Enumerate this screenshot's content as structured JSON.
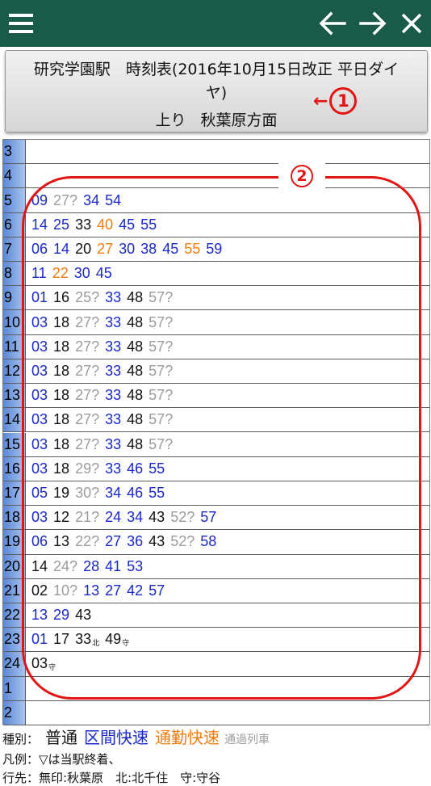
{
  "header": {
    "line1": "研究学園駅　時刻表(2016年10月15日改正 平日ダイ",
    "line2": "ヤ)",
    "direction": "上り",
    "destination": "秋葉原方面"
  },
  "annotations": {
    "marker1": "①",
    "marker1_arrow": "←",
    "marker2": "②",
    "accent": "#e31414"
  },
  "colors": {
    "topbar": "#1a5a48",
    "normal": "#111111",
    "rapid": "#1a28c8",
    "commute": "#f07c10",
    "pass": "#9c9c9c",
    "hour_cell": "#7aa2e4"
  },
  "icons": [
    "menu-icon",
    "back-arrow-icon",
    "forward-arrow-icon",
    "close-icon"
  ],
  "timetable": [
    {
      "hour": "3",
      "trains": []
    },
    {
      "hour": "4",
      "trains": []
    },
    {
      "hour": "5",
      "trains": [
        {
          "m": "09",
          "t": "rapid"
        },
        {
          "m": "27?",
          "t": "pass"
        },
        {
          "m": "34",
          "t": "rapid"
        },
        {
          "m": "54",
          "t": "rapid"
        }
      ]
    },
    {
      "hour": "6",
      "trains": [
        {
          "m": "14",
          "t": "rapid"
        },
        {
          "m": "25",
          "t": "rapid"
        },
        {
          "m": "33",
          "t": "normal"
        },
        {
          "m": "40",
          "t": "commute"
        },
        {
          "m": "45",
          "t": "rapid"
        },
        {
          "m": "55",
          "t": "rapid"
        }
      ]
    },
    {
      "hour": "7",
      "trains": [
        {
          "m": "06",
          "t": "rapid"
        },
        {
          "m": "14",
          "t": "rapid"
        },
        {
          "m": "20",
          "t": "normal"
        },
        {
          "m": "27",
          "t": "commute"
        },
        {
          "m": "30",
          "t": "rapid"
        },
        {
          "m": "38",
          "t": "rapid"
        },
        {
          "m": "45",
          "t": "rapid"
        },
        {
          "m": "55",
          "t": "commute"
        },
        {
          "m": "59",
          "t": "rapid"
        }
      ]
    },
    {
      "hour": "8",
      "trains": [
        {
          "m": "11",
          "t": "rapid"
        },
        {
          "m": "22",
          "t": "commute"
        },
        {
          "m": "30",
          "t": "rapid"
        },
        {
          "m": "45",
          "t": "rapid"
        }
      ]
    },
    {
      "hour": "9",
      "trains": [
        {
          "m": "01",
          "t": "rapid"
        },
        {
          "m": "16",
          "t": "normal"
        },
        {
          "m": "25?",
          "t": "pass"
        },
        {
          "m": "33",
          "t": "rapid"
        },
        {
          "m": "48",
          "t": "normal"
        },
        {
          "m": "57?",
          "t": "pass"
        }
      ]
    },
    {
      "hour": "10",
      "trains": [
        {
          "m": "03",
          "t": "rapid"
        },
        {
          "m": "18",
          "t": "normal"
        },
        {
          "m": "27?",
          "t": "pass"
        },
        {
          "m": "33",
          "t": "rapid"
        },
        {
          "m": "48",
          "t": "normal"
        },
        {
          "m": "57?",
          "t": "pass"
        }
      ]
    },
    {
      "hour": "11",
      "trains": [
        {
          "m": "03",
          "t": "rapid"
        },
        {
          "m": "18",
          "t": "normal"
        },
        {
          "m": "27?",
          "t": "pass"
        },
        {
          "m": "33",
          "t": "rapid"
        },
        {
          "m": "48",
          "t": "normal"
        },
        {
          "m": "57?",
          "t": "pass"
        }
      ]
    },
    {
      "hour": "12",
      "trains": [
        {
          "m": "03",
          "t": "rapid"
        },
        {
          "m": "18",
          "t": "normal"
        },
        {
          "m": "27?",
          "t": "pass"
        },
        {
          "m": "33",
          "t": "rapid"
        },
        {
          "m": "48",
          "t": "normal"
        },
        {
          "m": "57?",
          "t": "pass"
        }
      ]
    },
    {
      "hour": "13",
      "trains": [
        {
          "m": "03",
          "t": "rapid"
        },
        {
          "m": "18",
          "t": "normal"
        },
        {
          "m": "27?",
          "t": "pass"
        },
        {
          "m": "33",
          "t": "rapid"
        },
        {
          "m": "48",
          "t": "normal"
        },
        {
          "m": "57?",
          "t": "pass"
        }
      ]
    },
    {
      "hour": "14",
      "trains": [
        {
          "m": "03",
          "t": "rapid"
        },
        {
          "m": "18",
          "t": "normal"
        },
        {
          "m": "27?",
          "t": "pass"
        },
        {
          "m": "33",
          "t": "rapid"
        },
        {
          "m": "48",
          "t": "normal"
        },
        {
          "m": "57?",
          "t": "pass"
        }
      ]
    },
    {
      "hour": "15",
      "trains": [
        {
          "m": "03",
          "t": "rapid"
        },
        {
          "m": "18",
          "t": "normal"
        },
        {
          "m": "27?",
          "t": "pass"
        },
        {
          "m": "33",
          "t": "rapid"
        },
        {
          "m": "48",
          "t": "normal"
        },
        {
          "m": "57?",
          "t": "pass"
        }
      ]
    },
    {
      "hour": "16",
      "trains": [
        {
          "m": "03",
          "t": "rapid"
        },
        {
          "m": "18",
          "t": "normal"
        },
        {
          "m": "29?",
          "t": "pass"
        },
        {
          "m": "33",
          "t": "rapid"
        },
        {
          "m": "46",
          "t": "rapid"
        },
        {
          "m": "55",
          "t": "rapid"
        }
      ]
    },
    {
      "hour": "17",
      "trains": [
        {
          "m": "05",
          "t": "rapid"
        },
        {
          "m": "19",
          "t": "normal"
        },
        {
          "m": "30?",
          "t": "pass"
        },
        {
          "m": "34",
          "t": "rapid"
        },
        {
          "m": "46",
          "t": "rapid"
        },
        {
          "m": "55",
          "t": "rapid"
        }
      ]
    },
    {
      "hour": "18",
      "trains": [
        {
          "m": "03",
          "t": "rapid"
        },
        {
          "m": "12",
          "t": "normal"
        },
        {
          "m": "21?",
          "t": "pass"
        },
        {
          "m": "24",
          "t": "rapid"
        },
        {
          "m": "34",
          "t": "rapid"
        },
        {
          "m": "43",
          "t": "normal"
        },
        {
          "m": "52?",
          "t": "pass"
        },
        {
          "m": "57",
          "t": "rapid"
        }
      ]
    },
    {
      "hour": "19",
      "trains": [
        {
          "m": "06",
          "t": "rapid"
        },
        {
          "m": "13",
          "t": "normal"
        },
        {
          "m": "22?",
          "t": "pass"
        },
        {
          "m": "27",
          "t": "rapid"
        },
        {
          "m": "36",
          "t": "rapid"
        },
        {
          "m": "43",
          "t": "normal"
        },
        {
          "m": "52?",
          "t": "pass"
        },
        {
          "m": "58",
          "t": "rapid"
        }
      ]
    },
    {
      "hour": "20",
      "trains": [
        {
          "m": "14",
          "t": "normal"
        },
        {
          "m": "24?",
          "t": "pass"
        },
        {
          "m": "28",
          "t": "rapid"
        },
        {
          "m": "41",
          "t": "rapid"
        },
        {
          "m": "53",
          "t": "rapid"
        }
      ]
    },
    {
      "hour": "21",
      "trains": [
        {
          "m": "02",
          "t": "normal"
        },
        {
          "m": "10?",
          "t": "pass"
        },
        {
          "m": "13",
          "t": "rapid"
        },
        {
          "m": "27",
          "t": "rapid"
        },
        {
          "m": "42",
          "t": "rapid"
        },
        {
          "m": "57",
          "t": "rapid"
        }
      ]
    },
    {
      "hour": "22",
      "trains": [
        {
          "m": "13",
          "t": "rapid"
        },
        {
          "m": "29",
          "t": "rapid"
        },
        {
          "m": "43",
          "t": "normal"
        }
      ]
    },
    {
      "hour": "23",
      "trains": [
        {
          "m": "01",
          "t": "rapid"
        },
        {
          "m": "17",
          "t": "normal"
        },
        {
          "m": "33",
          "t": "normal",
          "s": "北"
        },
        {
          "m": "49",
          "t": "normal",
          "s": "守"
        }
      ]
    },
    {
      "hour": "24",
      "trains": [
        {
          "m": "03",
          "t": "normal",
          "s": "守"
        }
      ]
    },
    {
      "hour": "1",
      "trains": []
    },
    {
      "hour": "2",
      "trains": []
    }
  ],
  "legend": {
    "type_label": "種別：",
    "normal": "普通",
    "rapid": "区間快速",
    "commute": "通勤快速",
    "pass": "通過列車",
    "note": "凡例：▽は当駅終着、",
    "dest": "行先：無印:秋葉原　北:北千住　守:守谷"
  }
}
